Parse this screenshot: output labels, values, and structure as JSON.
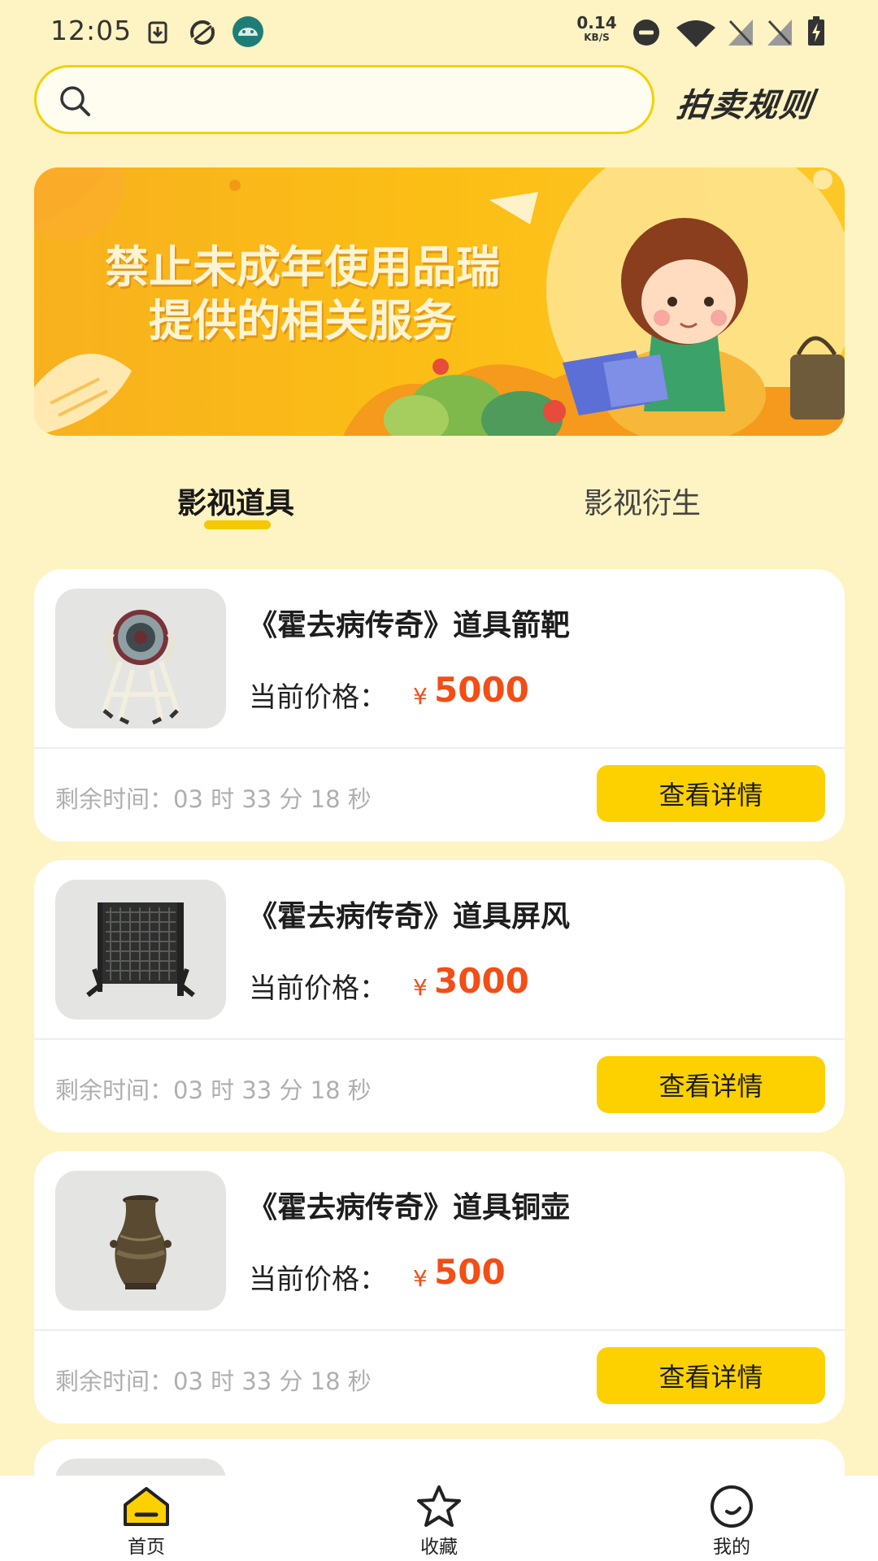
{
  "status_bar": {
    "time": "12:05",
    "net_speed_value": "0.14",
    "net_speed_unit": "KB/S",
    "icons": [
      "download-icon",
      "sync-icon",
      "android-icon",
      "dnd-icon",
      "wifi-icon",
      "no-sim-icon",
      "no-sim-icon",
      "battery-charging-icon"
    ]
  },
  "search": {
    "placeholder": "",
    "value": ""
  },
  "header": {
    "rules_label": "拍卖规则"
  },
  "banner": {
    "line1": "禁止未成年使用品瑞",
    "line2": "提供的相关服务"
  },
  "tabs": [
    {
      "label": "影视道具",
      "active": true
    },
    {
      "label": "影视衍生",
      "active": false
    }
  ],
  "items": [
    {
      "title": "《霍去病传奇》道具箭靶",
      "price_label": "当前价格：",
      "currency": "¥",
      "price": "5000",
      "remaining": "剩余时间：03 时 33 分 18 秒",
      "button": "查看详情",
      "image_icon": "archery-target-icon"
    },
    {
      "title": "《霍去病传奇》道具屏风",
      "price_label": "当前价格：",
      "currency": "¥",
      "price": "3000",
      "remaining": "剩余时间：03 时 33 分 18 秒",
      "button": "查看详情",
      "image_icon": "folding-screen-icon"
    },
    {
      "title": "《霍去病传奇》道具铜壶",
      "price_label": "当前价格：",
      "currency": "¥",
      "price": "500",
      "remaining": "剩余时间：03 时 33 分 18 秒",
      "button": "查看详情",
      "image_icon": "bronze-vase-icon"
    }
  ],
  "bottom_nav": [
    {
      "label": "首页",
      "icon": "home-icon",
      "active": true
    },
    {
      "label": "收藏",
      "icon": "star-icon",
      "active": false
    },
    {
      "label": "我的",
      "icon": "profile-icon",
      "active": false
    }
  ],
  "colors": {
    "background": "#FEF3C2",
    "accent": "#FDD100",
    "price": "#F24E16"
  }
}
